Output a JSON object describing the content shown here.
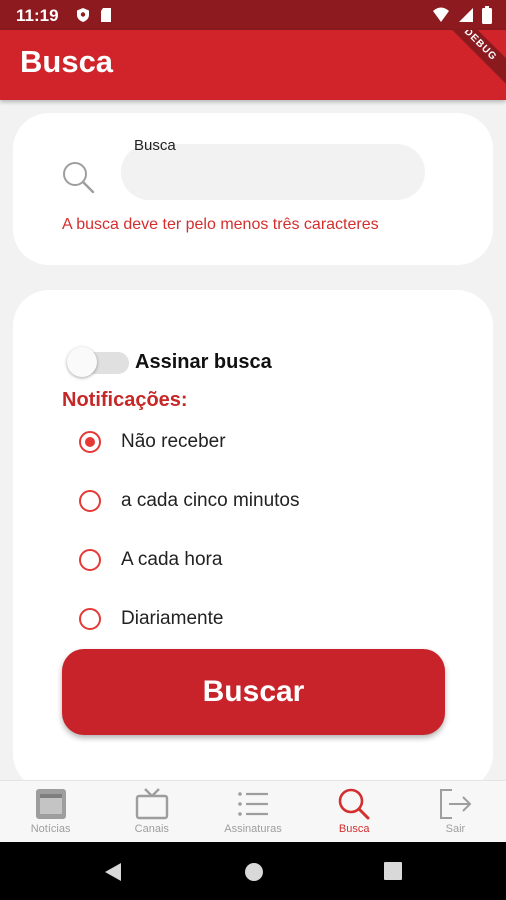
{
  "status_bar": {
    "time": "11:19"
  },
  "app_bar": {
    "title": "Busca",
    "debug_banner": "DEBUG"
  },
  "search": {
    "label": "Busca",
    "value": "",
    "error": "A busca deve ter pelo menos três caracteres"
  },
  "subscription": {
    "toggle_label": "Assinar busca",
    "toggle_on": false,
    "notifications_label": "Notificações:",
    "options": [
      {
        "label": "Não receber",
        "selected": true
      },
      {
        "label": "a cada cinco minutos",
        "selected": false
      },
      {
        "label": "A cada hora",
        "selected": false
      },
      {
        "label": "Diariamente",
        "selected": false
      }
    ],
    "button_label": "Buscar"
  },
  "bottom_nav": {
    "items": [
      {
        "label": "Notícias",
        "icon": "news-icon",
        "active": false
      },
      {
        "label": "Canais",
        "icon": "tv-icon",
        "active": false
      },
      {
        "label": "Assinaturas",
        "icon": "list-icon",
        "active": false
      },
      {
        "label": "Busca",
        "icon": "search-icon",
        "active": true
      },
      {
        "label": "Sair",
        "icon": "logout-icon",
        "active": false
      }
    ]
  },
  "colors": {
    "primary": "#d0232a",
    "status_bar": "#8c1a1f",
    "accent": "#e53935"
  }
}
